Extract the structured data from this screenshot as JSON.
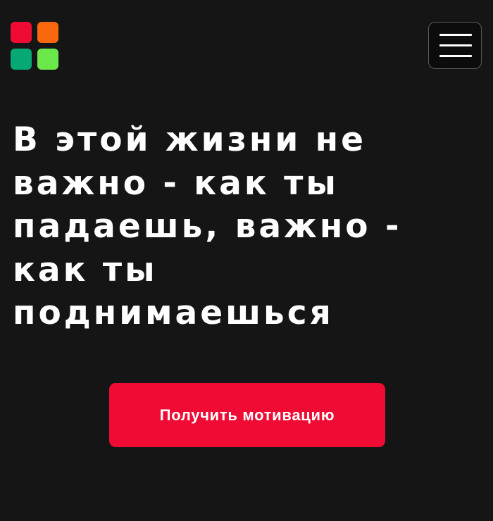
{
  "colors": {
    "background": "#151515",
    "text": "#ffffff",
    "accent": "#ef0b34"
  },
  "logo": {
    "icon": "four-colored-squares-logo",
    "tiles": [
      "#ef0b34",
      "#f9680f",
      "#06a876",
      "#6be84a"
    ]
  },
  "header": {
    "menu_icon": "hamburger-menu-icon"
  },
  "hero": {
    "title": "В этой жизни не важно - как ты падаешь, важно - как ты поднимаешься"
  },
  "cta": {
    "label": "Получить мотивацию"
  }
}
